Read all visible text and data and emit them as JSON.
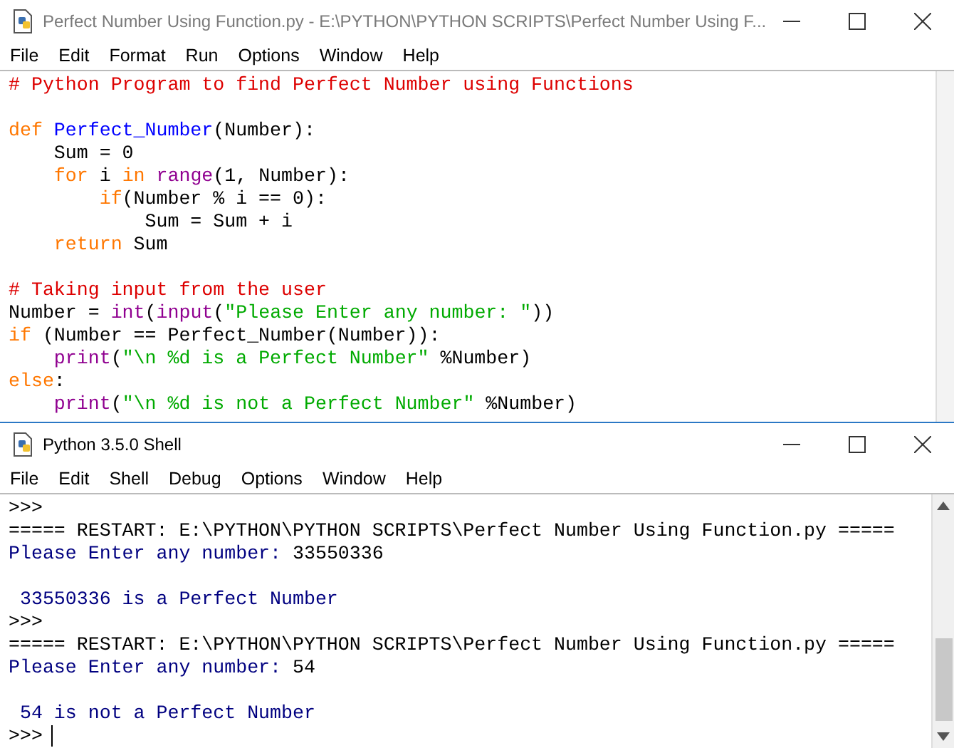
{
  "editor": {
    "title": "Perfect Number Using Function.py - E:\\PYTHON\\PYTHON SCRIPTS\\Perfect Number Using F...",
    "menu": [
      "File",
      "Edit",
      "Format",
      "Run",
      "Options",
      "Window",
      "Help"
    ],
    "lines": [
      {
        "kind": "code",
        "tokens": [
          {
            "kind": "comment",
            "text": "# Python Program to find Perfect Number using Functions"
          }
        ]
      },
      {
        "kind": "blank"
      },
      {
        "kind": "code",
        "tokens": [
          {
            "kind": "keyword",
            "text": "def "
          },
          {
            "kind": "defname",
            "text": "Perfect_Number"
          },
          {
            "kind": "plain",
            "text": "(Number):"
          }
        ]
      },
      {
        "kind": "code",
        "tokens": [
          {
            "kind": "plain",
            "text": "    Sum = 0"
          }
        ]
      },
      {
        "kind": "code",
        "tokens": [
          {
            "kind": "keyword",
            "text": "    for"
          },
          {
            "kind": "plain",
            "text": " i "
          },
          {
            "kind": "keyword",
            "text": "in "
          },
          {
            "kind": "builtin",
            "text": "range"
          },
          {
            "kind": "plain",
            "text": "(1, Number):"
          }
        ]
      },
      {
        "kind": "code",
        "tokens": [
          {
            "kind": "keyword",
            "text": "        if"
          },
          {
            "kind": "plain",
            "text": "(Number % i == 0):"
          }
        ]
      },
      {
        "kind": "code",
        "tokens": [
          {
            "kind": "plain",
            "text": "            Sum = Sum + i"
          }
        ]
      },
      {
        "kind": "code",
        "tokens": [
          {
            "kind": "keyword",
            "text": "    return"
          },
          {
            "kind": "plain",
            "text": " Sum"
          }
        ]
      },
      {
        "kind": "blank"
      },
      {
        "kind": "code",
        "tokens": [
          {
            "kind": "comment",
            "text": "# Taking input from the user"
          }
        ]
      },
      {
        "kind": "code",
        "tokens": [
          {
            "kind": "plain",
            "text": "Number = "
          },
          {
            "kind": "builtin",
            "text": "int"
          },
          {
            "kind": "plain",
            "text": "("
          },
          {
            "kind": "builtin",
            "text": "input"
          },
          {
            "kind": "plain",
            "text": "("
          },
          {
            "kind": "string",
            "text": "\"Please Enter any number: \""
          },
          {
            "kind": "plain",
            "text": "))"
          }
        ]
      },
      {
        "kind": "code",
        "tokens": [
          {
            "kind": "keyword",
            "text": "if"
          },
          {
            "kind": "plain",
            "text": " (Number == Perfect_Number(Number)):"
          }
        ]
      },
      {
        "kind": "code",
        "tokens": [
          {
            "kind": "builtin",
            "text": "    print"
          },
          {
            "kind": "plain",
            "text": "("
          },
          {
            "kind": "string",
            "text": "\"\\n %d is a Perfect Number\""
          },
          {
            "kind": "plain",
            "text": " %Number)"
          }
        ]
      },
      {
        "kind": "code",
        "tokens": [
          {
            "kind": "keyword",
            "text": "else"
          },
          {
            "kind": "plain",
            "text": ":"
          }
        ]
      },
      {
        "kind": "code",
        "tokens": [
          {
            "kind": "builtin",
            "text": "    print"
          },
          {
            "kind": "plain",
            "text": "("
          },
          {
            "kind": "string",
            "text": "\"\\n %d is not a Perfect Number\""
          },
          {
            "kind": "plain",
            "text": " %Number)"
          }
        ]
      }
    ]
  },
  "shell": {
    "title": "Python 3.5.0 Shell",
    "menu": [
      "File",
      "Edit",
      "Shell",
      "Debug",
      "Options",
      "Window",
      "Help"
    ],
    "lines": [
      {
        "kind": "code",
        "tokens": [
          {
            "kind": "prompt",
            "text": ">>>"
          }
        ]
      },
      {
        "kind": "code",
        "tokens": [
          {
            "kind": "plain",
            "text": "===== RESTART: E:\\PYTHON\\PYTHON SCRIPTS\\Perfect Number Using Function.py ====="
          }
        ]
      },
      {
        "kind": "code",
        "tokens": [
          {
            "kind": "output",
            "text": "Please Enter any number: "
          },
          {
            "kind": "plain",
            "text": "33550336"
          }
        ]
      },
      {
        "kind": "blank"
      },
      {
        "kind": "code",
        "tokens": [
          {
            "kind": "output",
            "text": " 33550336 is a Perfect Number"
          }
        ]
      },
      {
        "kind": "code",
        "tokens": [
          {
            "kind": "prompt",
            "text": ">>>"
          }
        ]
      },
      {
        "kind": "code",
        "tokens": [
          {
            "kind": "plain",
            "text": "===== RESTART: E:\\PYTHON\\PYTHON SCRIPTS\\Perfect Number Using Function.py ====="
          }
        ]
      },
      {
        "kind": "code",
        "tokens": [
          {
            "kind": "output",
            "text": "Please Enter any number: "
          },
          {
            "kind": "plain",
            "text": "54"
          }
        ]
      },
      {
        "kind": "blank"
      },
      {
        "kind": "code",
        "tokens": [
          {
            "kind": "output",
            "text": " 54 is not a Perfect Number"
          }
        ]
      },
      {
        "kind": "cursor",
        "tokens": [
          {
            "kind": "prompt",
            "text": ">>>"
          }
        ]
      }
    ]
  }
}
